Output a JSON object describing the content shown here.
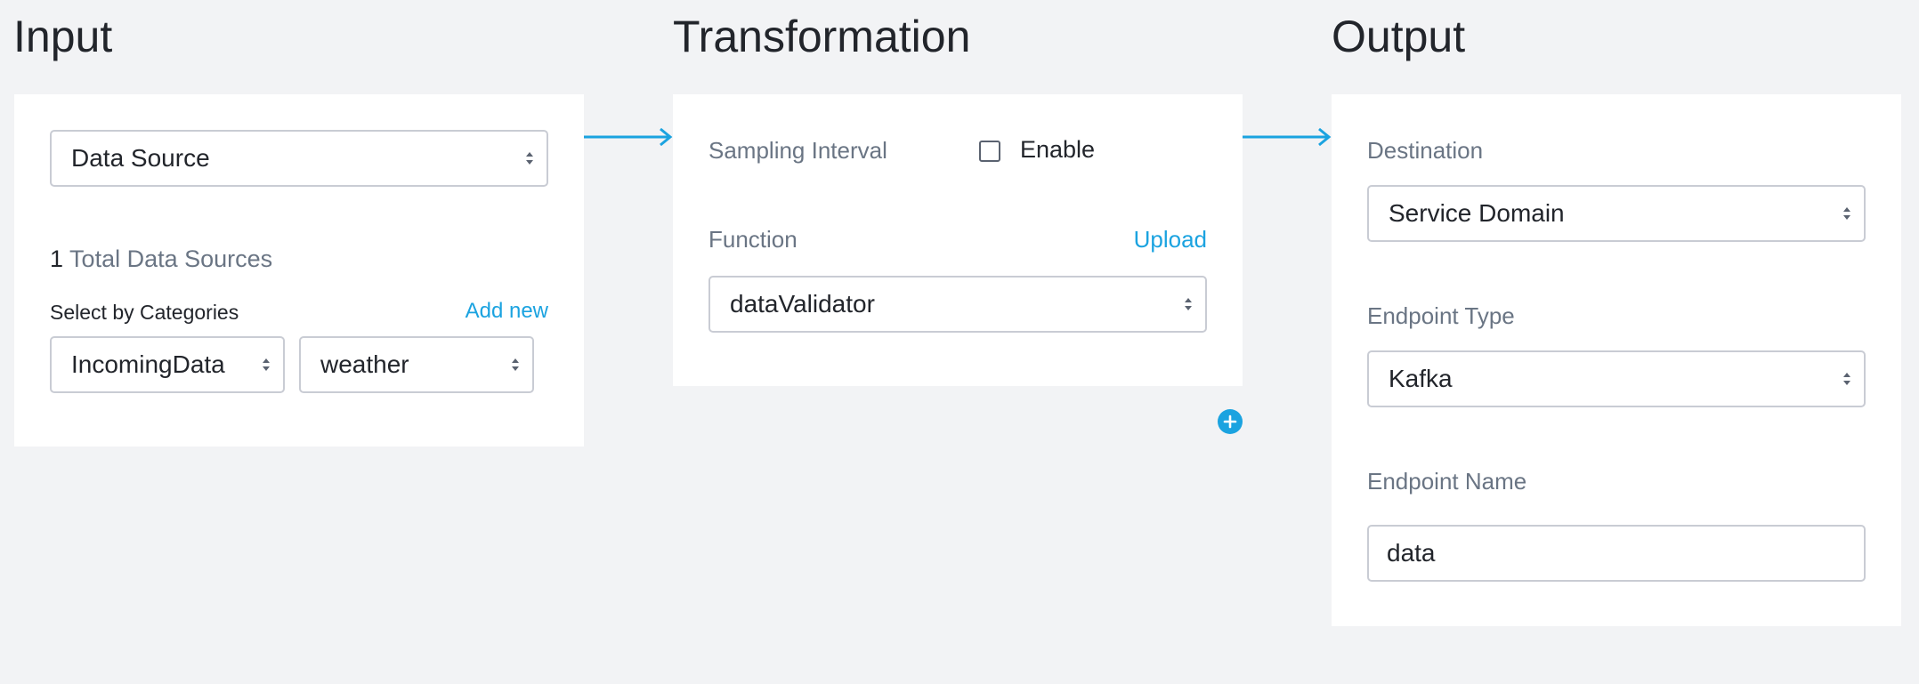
{
  "columns": {
    "input_title": "Input",
    "transformation_title": "Transformation",
    "output_title": "Output"
  },
  "input": {
    "data_source_select": "Data Source",
    "total_count": "1",
    "total_label": "Total Data Sources",
    "select_by_categories_label": "Select by Categories",
    "add_new_link": "Add new",
    "category_select": "IncomingData",
    "value_select": "weather"
  },
  "transformation": {
    "sampling_interval_label": "Sampling Interval",
    "enable_label": "Enable",
    "enable_checked": false,
    "function_label": "Function",
    "upload_link": "Upload",
    "function_select": "dataValidator"
  },
  "output": {
    "destination_label": "Destination",
    "destination_select": "Service Domain",
    "endpoint_type_label": "Endpoint Type",
    "endpoint_type_select": "Kafka",
    "endpoint_name_label": "Endpoint Name",
    "endpoint_name_value": "data"
  },
  "colors": {
    "accent": "#1ba3e0",
    "background": "#f2f3f5",
    "card": "#ffffff",
    "muted_text": "#6a7584"
  },
  "icons": {
    "select_caret": "updown-caret-icon",
    "flow_arrow": "arrow-right-icon",
    "add": "plus-circle-icon"
  }
}
